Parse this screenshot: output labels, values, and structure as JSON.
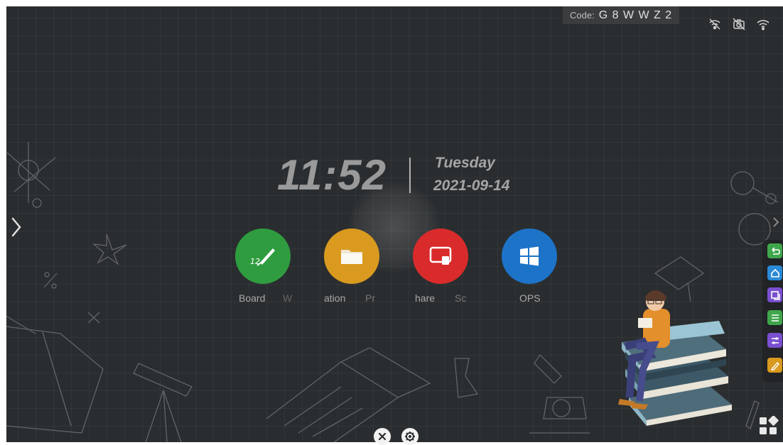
{
  "connection": {
    "code_label": "Code:",
    "code_value": "G 8 W W Z 2"
  },
  "status_icons": [
    "network-off-icon",
    "camera-off-icon",
    "wifi-icon"
  ],
  "clock": {
    "time": "11:52",
    "weekday": "Tuesday",
    "date": "2021-09-14"
  },
  "apps": [
    {
      "label": "Board",
      "icon": "pen-board-icon",
      "color": "#2f9d3f"
    },
    {
      "label": "W",
      "icon": "",
      "color": ""
    },
    {
      "label": "ation",
      "icon": "folder-icon",
      "color": "#d99a1f"
    },
    {
      "label": "Pr",
      "icon": "",
      "color": ""
    },
    {
      "label": "hare",
      "icon": "screen-share-icon",
      "color": "#d92b2b"
    },
    {
      "label": "Sc",
      "icon": "",
      "color": ""
    },
    {
      "label": "OPS",
      "icon": "windows-icon",
      "color": "#1d73c8"
    }
  ],
  "right_dock": [
    {
      "name": "back",
      "icon": "back-icon",
      "color": "#3fa64b"
    },
    {
      "name": "home",
      "icon": "home-icon",
      "color": "#2a8ad6"
    },
    {
      "name": "recent",
      "icon": "windows-stack-icon",
      "color": "#7a4fd0"
    },
    {
      "name": "menu",
      "icon": "menu-icon",
      "color": "#3fa64b"
    },
    {
      "name": "settings",
      "icon": "sliders-icon",
      "color": "#7a4fd0"
    },
    {
      "name": "annotate",
      "icon": "pencil-icon",
      "color": "#d99a1f"
    }
  ],
  "bottom_controls": [
    "close-icon",
    "settings-gear-icon"
  ],
  "colors": {
    "background": "#2a2d2f",
    "text": "#a8a8a8"
  }
}
